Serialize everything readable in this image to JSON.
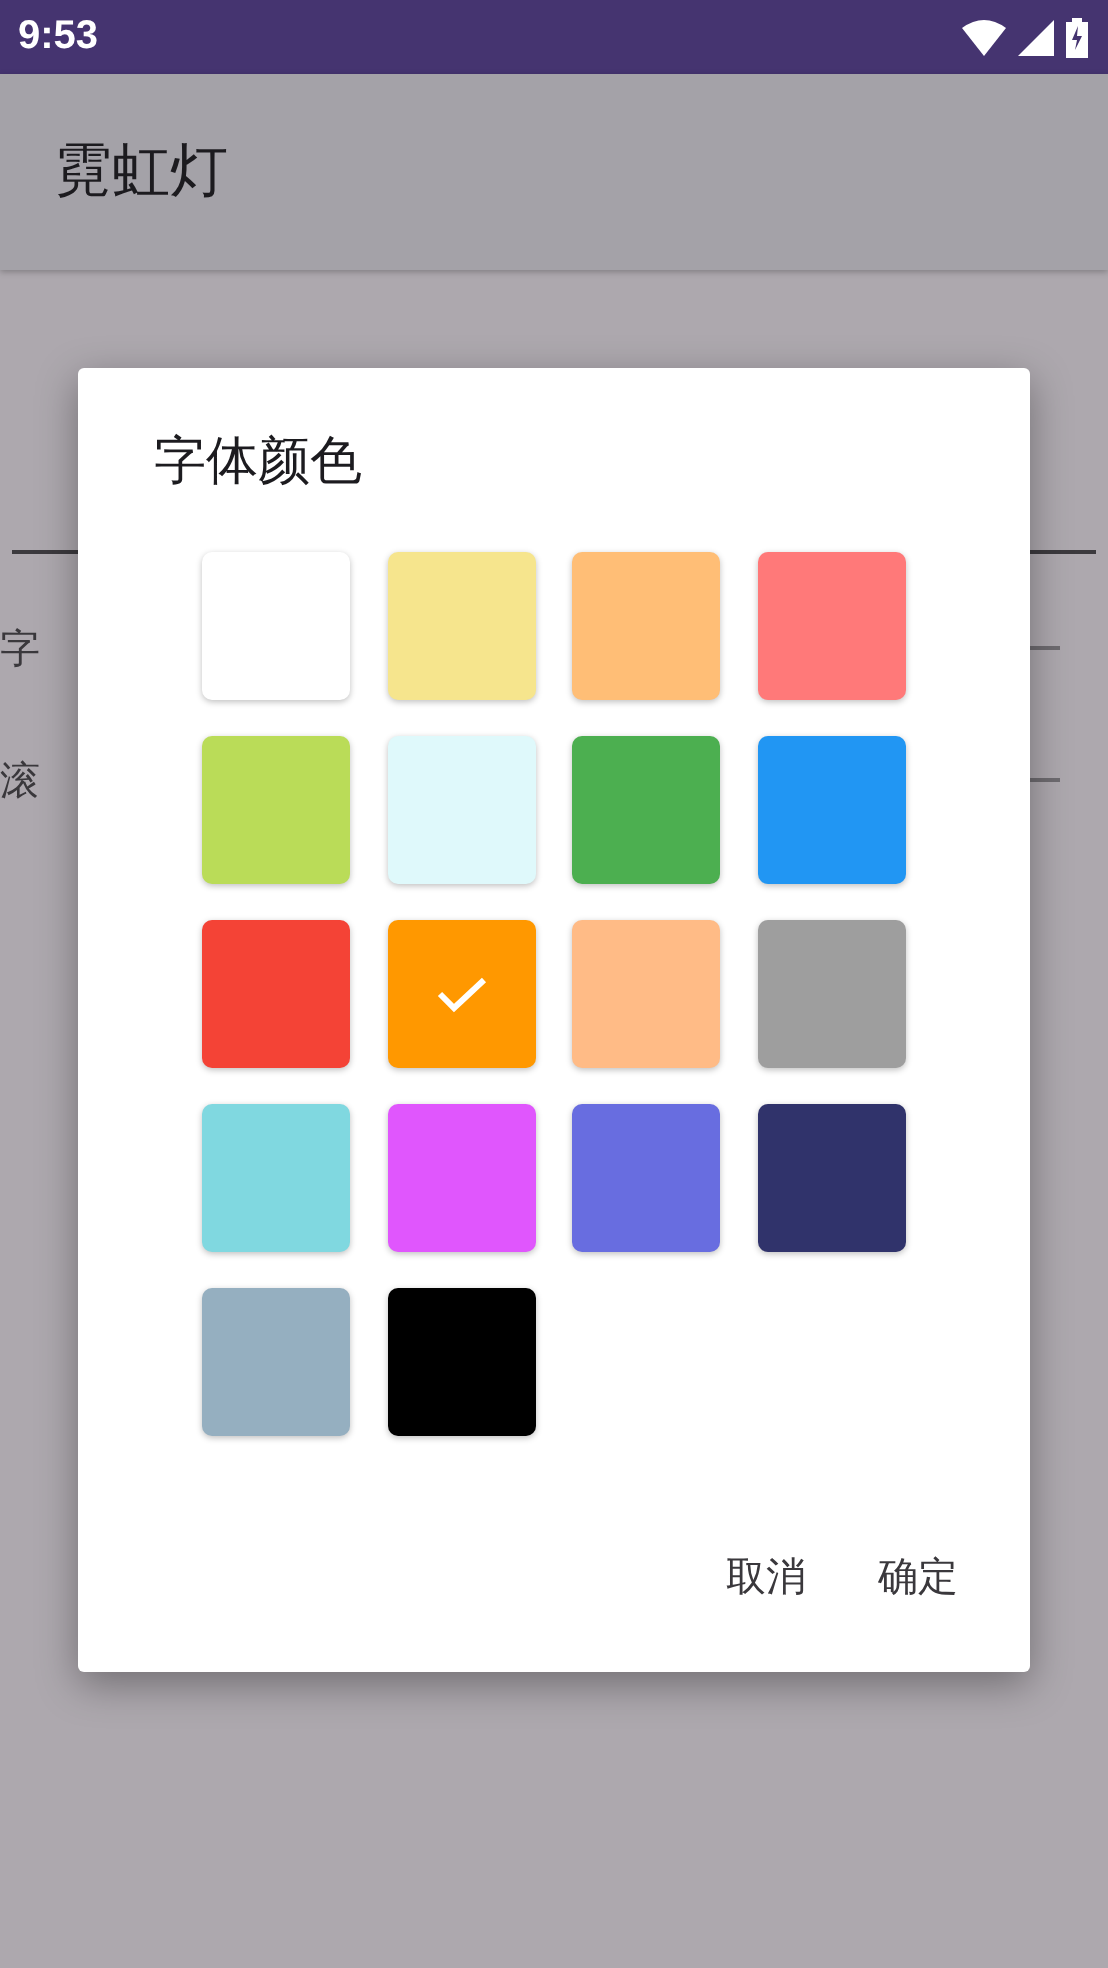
{
  "status_bar": {
    "time": "9:53"
  },
  "app_bar": {
    "title": "霓虹灯"
  },
  "form": {
    "labels": [
      "字",
      "滚"
    ]
  },
  "dialog": {
    "title": "字体颜色",
    "swatches": [
      {
        "color": "#ffffff",
        "selected": false
      },
      {
        "color": "#f6e58d",
        "selected": false
      },
      {
        "color": "#ffbe76",
        "selected": false
      },
      {
        "color": "#ff7979",
        "selected": false
      },
      {
        "color": "#badc58",
        "selected": false
      },
      {
        "color": "#dff9fb",
        "selected": false
      },
      {
        "color": "#4caf50",
        "selected": false
      },
      {
        "color": "#2196f3",
        "selected": false
      },
      {
        "color": "#f44336",
        "selected": false
      },
      {
        "color": "#ff9800",
        "selected": true
      },
      {
        "color": "#ffbb86",
        "selected": false
      },
      {
        "color": "#9e9e9e",
        "selected": false
      },
      {
        "color": "#80d8e0",
        "selected": false
      },
      {
        "color": "#e056fd",
        "selected": false
      },
      {
        "color": "#686de0",
        "selected": false
      },
      {
        "color": "#30336b",
        "selected": false
      },
      {
        "color": "#95afc0",
        "selected": false
      },
      {
        "color": "#000000",
        "selected": false
      }
    ],
    "buttons": [
      "取消",
      "确定"
    ]
  }
}
